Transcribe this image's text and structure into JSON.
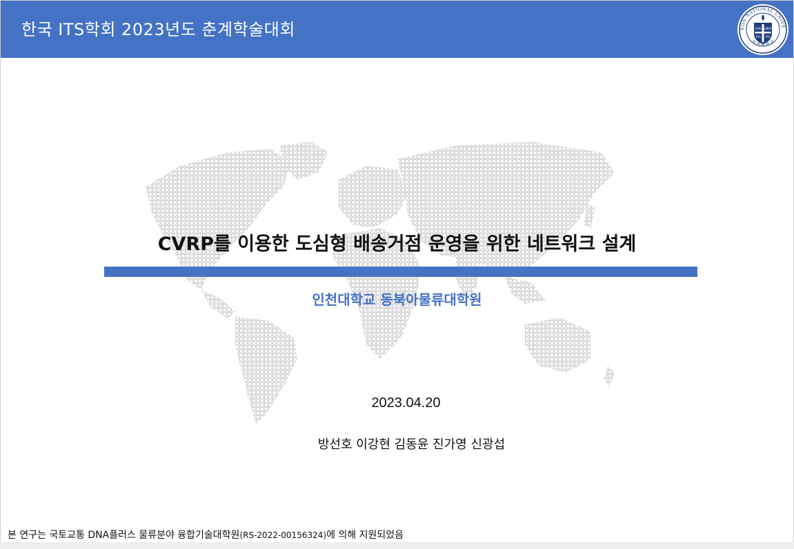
{
  "header": {
    "title": "한국 ITS학회 2023년도 춘계학술대회",
    "logo": {
      "ring_text_top": "INCHEON NATIONAL UNIVERSITY",
      "ring_text_bottom": "인 천 대 학 교",
      "shield_left": "VERI",
      "shield_right": "LIBER",
      "shield_bottom_left": "TAS",
      "shield_bottom_right": "TAS"
    }
  },
  "title": "CVRP를 이용한 도심형 배송거점 운영을 위한 네트워크 설계",
  "affiliation": "인천대학교 동북아물류대학원",
  "date": "2023.04.20",
  "authors": "방선호 이강현 김동윤 진가영 신광섭",
  "footer": {
    "prefix": "본 연구는 국토교통 DNA플러스 물류분야 융합기술대학원",
    "code": "(RS-2022-00156324)",
    "suffix": "에 의해 지원되었음"
  },
  "colors": {
    "accent": "#4472c4",
    "map_dots": "#c8c8c8"
  }
}
